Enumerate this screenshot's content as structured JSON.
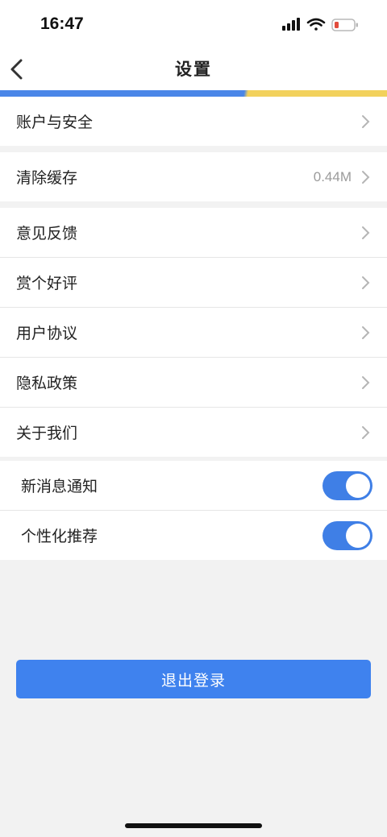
{
  "status": {
    "time": "16:47",
    "battery_color": "#e24b3b"
  },
  "nav": {
    "title": "设置",
    "back_icon": "chevron-left-icon"
  },
  "colors": {
    "accent_blue": "#4a86e8",
    "accent_yellow": "#f2d15c",
    "toggle_on": "#3f7fe6",
    "button": "#3f82ee"
  },
  "group1": [
    {
      "label": "账户与安全"
    }
  ],
  "group2": [
    {
      "label": "清除缓存",
      "value": "0.44M"
    }
  ],
  "group3": [
    {
      "label": "意见反馈"
    },
    {
      "label": "赏个好评"
    },
    {
      "label": "用户协议"
    },
    {
      "label": "隐私政策"
    },
    {
      "label": "关于我们"
    }
  ],
  "toggles": [
    {
      "label": "新消息通知",
      "on": true
    },
    {
      "label": "个性化推荐",
      "on": true
    }
  ],
  "logout": {
    "label": "退出登录"
  }
}
